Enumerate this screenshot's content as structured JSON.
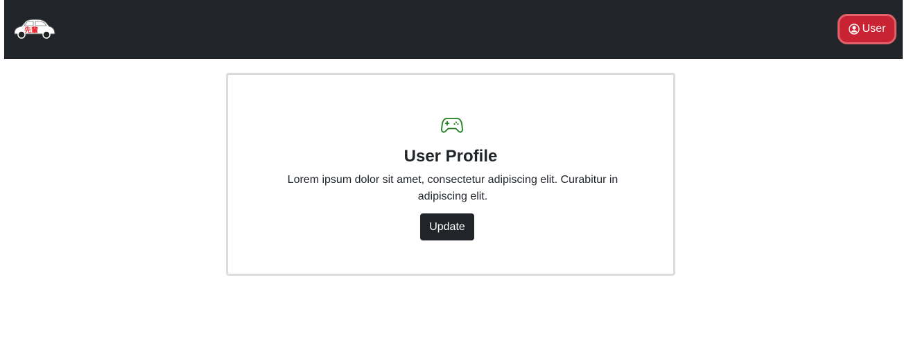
{
  "navbar": {
    "logo_text": "先輩",
    "user_button_label": "User"
  },
  "card": {
    "title": "User Profile",
    "description": "Lorem ipsum dolor sit amet, consectetur adipiscing elit. Curabitur in adipiscing elit.",
    "button_label": "Update"
  },
  "colors": {
    "navbar_bg": "#212529",
    "user_button_bg": "#c82333",
    "icon_green": "#1a7f1a",
    "update_button_bg": "#212529"
  },
  "icons": {
    "logo": "car-logo-icon",
    "user": "user-circle-icon",
    "card": "gamepad-icon"
  }
}
